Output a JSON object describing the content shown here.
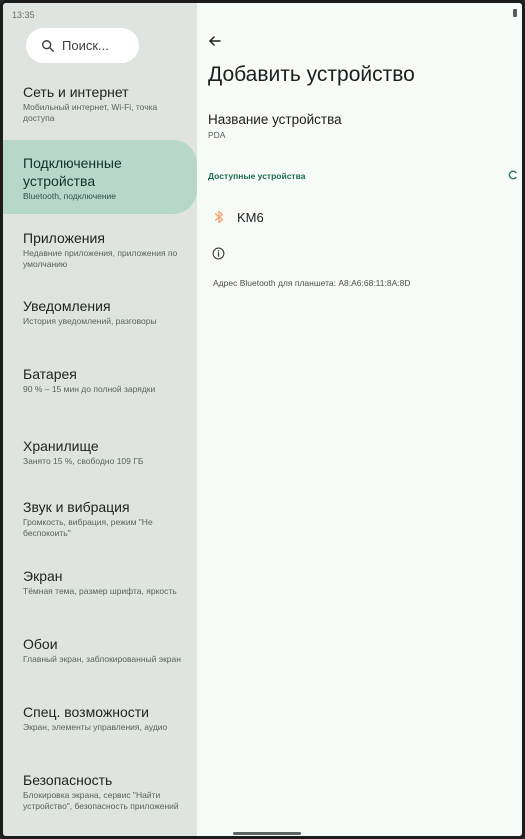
{
  "status_bar": {
    "time": "13:35"
  },
  "search": {
    "placeholder": "Поиск..."
  },
  "sidebar": {
    "items": [
      {
        "title": "Сеть и интернет",
        "subtitle": "Мобильный интернет, Wi-Fi, точка доступа"
      },
      {
        "title": "Подключенные устройства",
        "subtitle": "Bluetooth, подключение"
      },
      {
        "title": "Приложения",
        "subtitle": "Недавние приложения, приложения по умолчанию"
      },
      {
        "title": "Уведомления",
        "subtitle": "История уведомлений, разговоры"
      },
      {
        "title": "Батарея",
        "subtitle": "90 % – 15 мин до полной зарядки"
      },
      {
        "title": "Хранилище",
        "subtitle": "Занято 15 %, свободно 109 ГБ"
      },
      {
        "title": "Звук и вибрация",
        "subtitle": "Громкость, вибрация, режим \"Не беспокоить\""
      },
      {
        "title": "Экран",
        "subtitle": "Тёмная тема, размер шрифта, яркость"
      },
      {
        "title": "Обои",
        "subtitle": "Главный экран, заблокированный экран"
      },
      {
        "title": "Спец. возможности",
        "subtitle": "Экран, элементы управления, аудио"
      },
      {
        "title": "Безопасность",
        "subtitle": "Блокировка экрана, сервис \"Найти устройство\", безопасность приложений"
      }
    ],
    "active_index": 1
  },
  "main": {
    "title": "Добавить устройство",
    "device_name": {
      "label": "Название устройства",
      "value": "PDA"
    },
    "available_header": "Доступные устройства",
    "devices": [
      {
        "name": "KM6"
      }
    ],
    "bt_address": "Адрес Bluetooth для планшета: A8:A6:68:11:8A:8D"
  },
  "icons": {
    "search": "search-icon",
    "back": "arrow-back-icon",
    "bluetooth": "bluetooth-icon",
    "info": "info-icon",
    "progress": "progress-spinner-icon"
  },
  "colors": {
    "sidebar_bg": "#dfe4e0",
    "active_item_bg": "#b7d7cb",
    "accent": "#1d6b54",
    "bluetooth_icon": "#f0a66e"
  }
}
